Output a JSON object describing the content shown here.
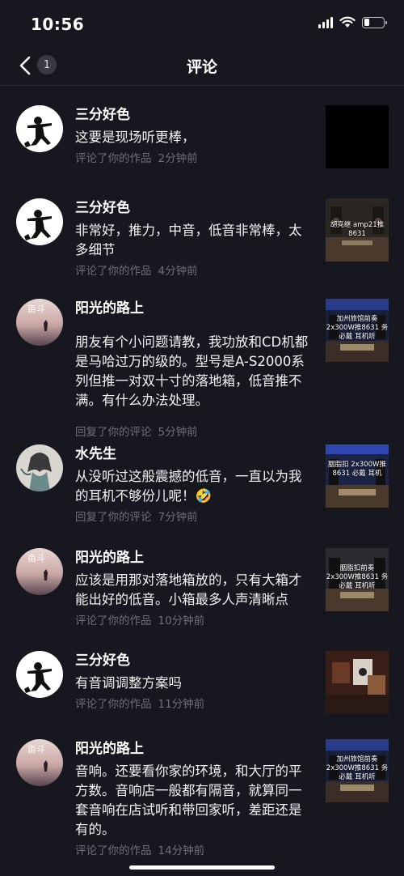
{
  "status_bar": {
    "time": "10:56"
  },
  "nav": {
    "title": "评论",
    "badge_count": "1"
  },
  "comments": [
    {
      "username": "三分好色",
      "text": "这要是现场听更棒，",
      "action": "评论了你的作品",
      "time": "2分钟前",
      "thumb_label": ""
    },
    {
      "username": "三分好色",
      "text": "非常好，推力，中音，低音非常棒，太多细节",
      "action": "评论了你的作品",
      "time": "4分钟前",
      "thumb_label": "胡亮继 amp21推8631"
    },
    {
      "username": "阳光的路上",
      "text": "朋友有个小问题请教，我功放和CD机都是马哈过万的级的。型号是A-S2000系列但推一对双十寸的落地箱，低音推不满。有什么办法处理。",
      "action": "回复了你的评论",
      "time": "5分钟前",
      "thumb_label": "加州旅馆前奏 2x300W推8631 务必戴 耳机听"
    },
    {
      "username": "水先生",
      "text": "从没听过这般震撼的低音，一直以为我的耳机不够份儿呢！🤣",
      "action": "回复了你的评论",
      "time": "7分钟前",
      "thumb_label": "胭脂扣 2x300W推8631 必戴 耳机"
    },
    {
      "username": "阳光的路上",
      "text": "应该是用那对落地箱放的，只有大箱才能出好的低音。小箱最多人声清晰点",
      "action": "评论了你的作品",
      "time": "10分钟前",
      "thumb_label": "胭脂扣前奏 2x300W推8631 务必戴 耳机听"
    },
    {
      "username": "三分好色",
      "text": "有音调调整方案吗",
      "action": "评论了你的作品",
      "time": "11分钟前",
      "thumb_label": ""
    },
    {
      "username": "阳光的路上",
      "text": "音响。还要看你家的环境，和大厅的平方数。音响店一般都有隔音，就算同一套音响在店试听和带回家听，差距还是有的。",
      "action": "评论了你的作品",
      "time": "14分钟前",
      "thumb_label": "加州旅馆前奏 2x300W推8631 务必戴 耳机听"
    }
  ],
  "colors": {
    "background": "#17171f",
    "meta_text": "#6f6f7a"
  }
}
